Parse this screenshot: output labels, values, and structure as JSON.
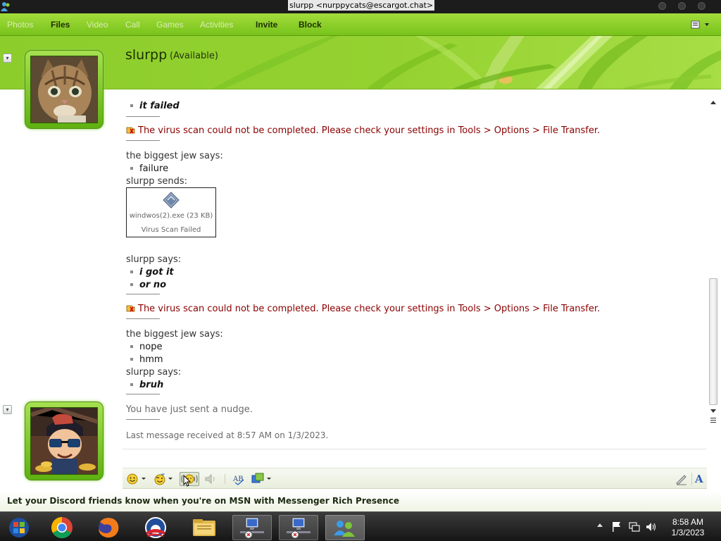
{
  "window": {
    "title": "slurpp <nurppycats@escargot.chat>"
  },
  "menu": {
    "items": [
      {
        "label": "Photos",
        "enabled": false
      },
      {
        "label": "Files",
        "enabled": true
      },
      {
        "label": "Video",
        "enabled": false
      },
      {
        "label": "Call",
        "enabled": false
      },
      {
        "label": "Games",
        "enabled": false
      },
      {
        "label": "Activities",
        "enabled": false
      },
      {
        "label": "Invite",
        "enabled": true
      },
      {
        "label": "Block",
        "enabled": true
      }
    ],
    "options_icon": "options-menu-icon"
  },
  "header": {
    "contact_name": "slurpp",
    "contact_status": "(Available)"
  },
  "conversation": {
    "top_partial_message": "it failed",
    "warning_text": "The virus scan could not be completed. Please check your settings in Tools > Options > File Transfer.",
    "block1_sender": "the biggest jew says:",
    "block1_msgs": [
      "failure"
    ],
    "block2_sender": "slurpp sends:",
    "file": {
      "name": "windwos(2).exe (23 KB)",
      "status": "Virus Scan Failed"
    },
    "block3_sender": "slurpp says:",
    "block3_msgs": [
      "i got it",
      "or no"
    ],
    "warning_text_2": "The virus scan could not be completed. Please check your settings in Tools > Options > File Transfer.",
    "block4_sender": "the biggest jew says:",
    "block4_msgs": [
      "nope",
      "hmm"
    ],
    "block5_sender": "slurpp says:",
    "block5_msgs": [
      "bruh"
    ],
    "nudge_text": "You have just sent a nudge.",
    "last_received": "Last message received at 8:57 AM on 1/3/2023."
  },
  "ad": {
    "text": "Let your Discord friends know when you're on MSN with Messenger Rich Presence"
  },
  "taskbar": {
    "apps": [
      "start-orb-icon",
      "chrome-icon",
      "firefox-icon",
      "obama-logo-icon",
      "file-explorer-icon",
      "network-computer-icon",
      "network-computer-icon",
      "messenger-icon"
    ],
    "time": "8:58 AM",
    "date": "1/3/2023"
  },
  "colors": {
    "menu_green": "#8fd02f",
    "warning_red": "#8b0000",
    "header_green": "#95d231"
  }
}
